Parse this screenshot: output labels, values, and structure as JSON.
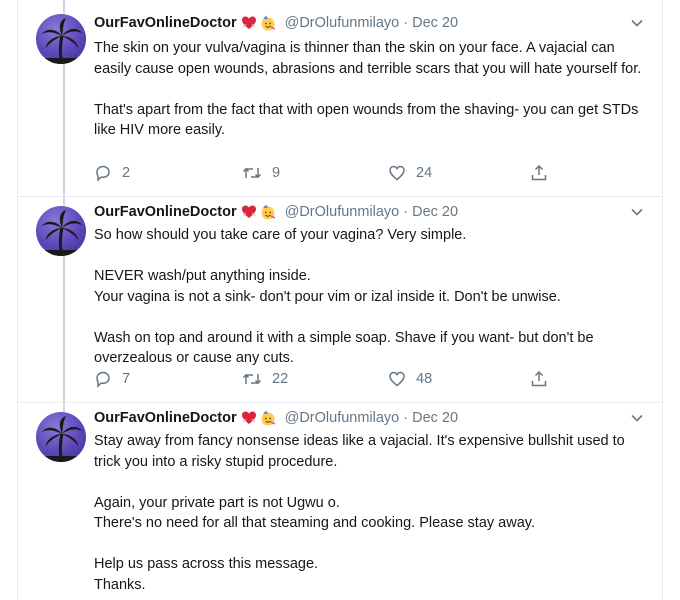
{
  "tweets": [
    {
      "name": "OurFavOnlineDoctor",
      "handle": "@DrOlufunmilayo",
      "separator": "·",
      "date": "Dec 20",
      "paragraphs": [
        "The skin on your vulva/vagina is thinner than the skin on your face. A vajacial can easily cause open wounds, abrasions and terrible scars that you will hate yourself for.",
        "That's apart from the fact that with open wounds from the shaving- you can get STDs like HIV more easily."
      ],
      "replies": "2",
      "retweets": "9",
      "likes": "24"
    },
    {
      "name": "OurFavOnlineDoctor",
      "handle": "@DrOlufunmilayo",
      "separator": "·",
      "date": "Dec 20",
      "paragraphs": [
        "So how should you take care of your vagina? Very simple.",
        "NEVER wash/put anything inside.\nYour vagina is not a sink- don't pour vim or izal inside it. Don't be unwise.",
        "Wash on top and around it with a simple soap. Shave if you want- but don't be overzealous or cause any cuts."
      ],
      "replies": "7",
      "retweets": "22",
      "likes": "48"
    },
    {
      "name": "OurFavOnlineDoctor",
      "handle": "@DrOlufunmilayo",
      "separator": "·",
      "date": "Dec 20",
      "paragraphs": [
        "Stay away from fancy nonsense ideas like a vajacial. It's expensive bullshit used to trick you into a risky stupid procedure.",
        "Again, your private part is not Ugwu o.\nThere's no need for all that steaming and cooking. Please stay away.",
        "Help us pass across this message.\nThanks."
      ]
    }
  ],
  "icons": {
    "avatar": "palm-tree-silhouette",
    "badge_1": "heart-emoji",
    "badge_2": "party-face-emoji",
    "caret": "chevron-down-icon",
    "reply": "reply-icon",
    "retweet": "retweet-icon",
    "like": "heart-icon",
    "share": "share-icon"
  },
  "colors": {
    "text": "#14171a",
    "muted": "#657786",
    "border": "#e6ecf0",
    "heart_emoji": "#d7263d",
    "avatar": "#5c46b8"
  }
}
